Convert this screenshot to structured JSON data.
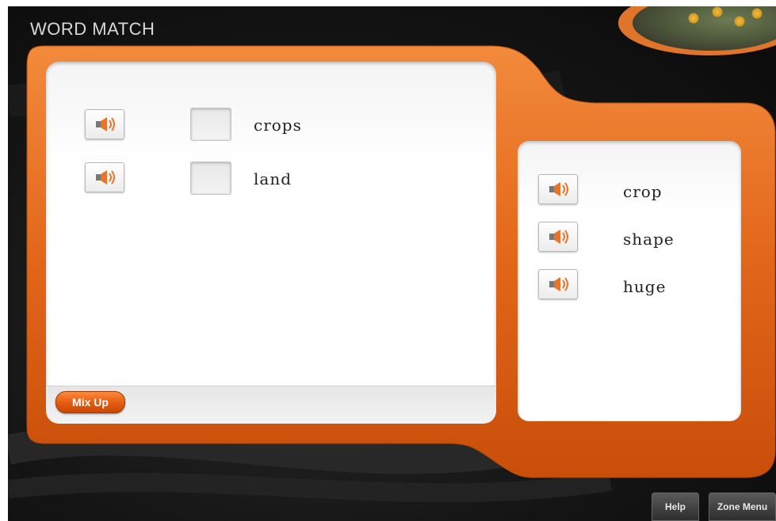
{
  "header": {
    "title": "WORD MATCH"
  },
  "artwork": {
    "icon": "sunflower-painting-icon"
  },
  "left_panel": {
    "rows": [
      {
        "word": "crops",
        "speaker_icon": "speaker-icon"
      },
      {
        "word": "land",
        "speaker_icon": "speaker-icon"
      }
    ],
    "mix_up_label": "Mix Up"
  },
  "right_panel": {
    "words": [
      {
        "word": "crop",
        "speaker_icon": "speaker-icon"
      },
      {
        "word": "shape",
        "speaker_icon": "speaker-icon"
      },
      {
        "word": "huge",
        "speaker_icon": "speaker-icon"
      }
    ]
  },
  "footer": {
    "help_label": "Help",
    "zone_menu_label": "Zone Menu"
  },
  "colors": {
    "accent": "#e2661a",
    "background": "#141414",
    "panel": "#ffffff"
  }
}
